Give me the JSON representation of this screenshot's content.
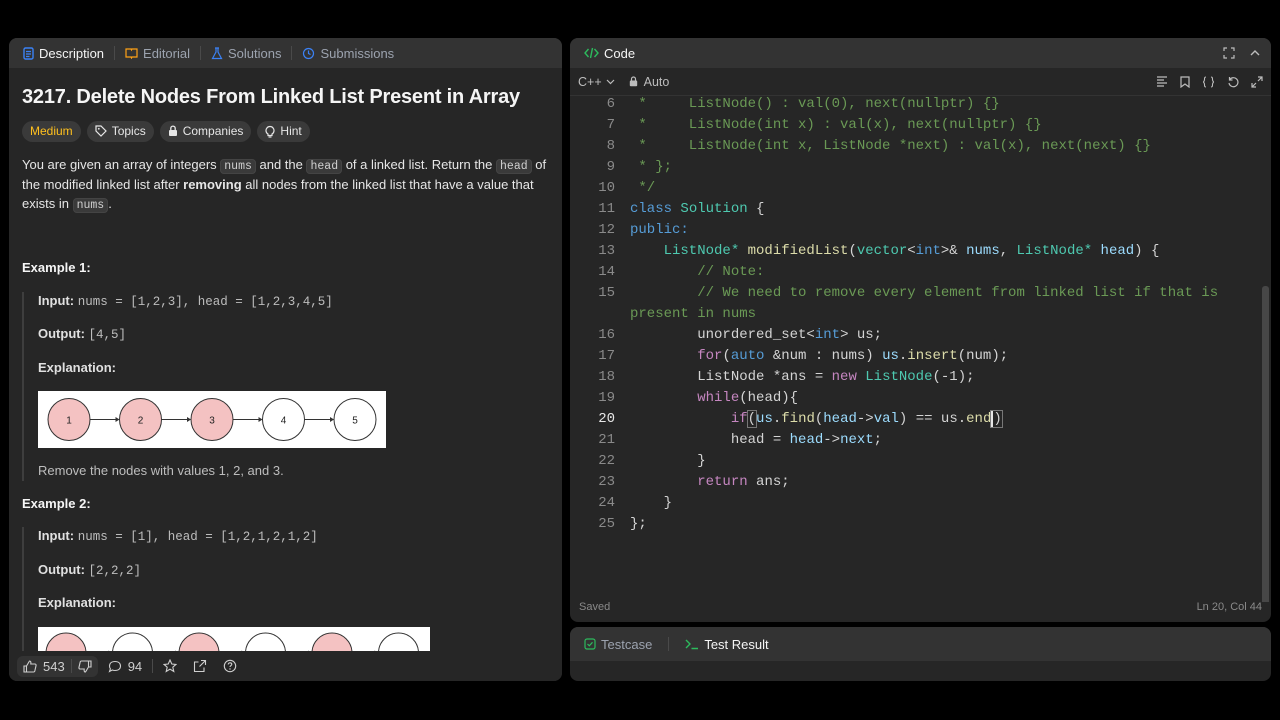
{
  "left_tabs": {
    "description": "Description",
    "editorial": "Editorial",
    "solutions": "Solutions",
    "submissions": "Submissions"
  },
  "problem": {
    "title": "3217. Delete Nodes From Linked List Present in Array",
    "difficulty": "Medium",
    "topics": "Topics",
    "companies": "Companies",
    "hint": "Hint",
    "statement": {
      "p1": "You are given an array of integers ",
      "c1": "nums",
      "p2": " and the ",
      "c2": "head",
      "p3": " of a linked list. Return the ",
      "c3": "head",
      "p4": " of the modified linked list after ",
      "b1": "removing",
      "p5": " all nodes from the linked list that have a value that exists in ",
      "c4": "nums",
      "p6": "."
    },
    "example1": {
      "heading": "Example 1:",
      "input_label": "Input:",
      "input": "nums = [1,2,3], head = [1,2,3,4,5]",
      "output_label": "Output:",
      "output": "[4,5]",
      "explanation_label": "Explanation:",
      "nodes": [
        "1",
        "2",
        "3",
        "4",
        "5"
      ],
      "removed": [
        true,
        true,
        true,
        false,
        false
      ],
      "note": "Remove the nodes with values 1, 2, and 3."
    },
    "example2": {
      "heading": "Example 2:",
      "input_label": "Input:",
      "input": "nums = [1], head = [1,2,1,2,1,2]",
      "output_label": "Output:",
      "output": "[2,2,2]",
      "explanation_label": "Explanation:",
      "removed": [
        true,
        false,
        true,
        false,
        true,
        false
      ]
    }
  },
  "footer": {
    "likes": "543",
    "comments": "94"
  },
  "code_panel": {
    "title": "Code",
    "language": "C++",
    "autosave": "Auto",
    "status_left": "Saved",
    "status_right": "Ln 20, Col 44",
    "active_line": 20,
    "lines": [
      {
        "num": "6"
      },
      {
        "num": "7"
      },
      {
        "num": "8"
      },
      {
        "num": "9"
      },
      {
        "num": "10"
      },
      {
        "num": "11"
      },
      {
        "num": "12"
      },
      {
        "num": "13"
      },
      {
        "num": "14"
      },
      {
        "num": "15"
      },
      {
        "num": ""
      },
      {
        "num": "16"
      },
      {
        "num": "17"
      },
      {
        "num": "18"
      },
      {
        "num": "19"
      },
      {
        "num": "20"
      },
      {
        "num": "21"
      },
      {
        "num": "22"
      },
      {
        "num": "23"
      },
      {
        "num": "24"
      },
      {
        "num": "25"
      }
    ]
  },
  "code_text": {
    "l6": " *     ListNode() : val(0), next(nullptr) {}",
    "l7": " *     ListNode(int x) : val(x), next(nullptr) {}",
    "l8": " *     ListNode(int x, ListNode *next) : val(x), next(next) {}",
    "l9": " * };",
    "l10": " */",
    "l11a": "class",
    "l11b": " Solution",
    "l11c": " {",
    "l12": "public:",
    "l13a": "    ListNode*",
    "l13b": " modifiedList",
    "l13c": "(",
    "l13d": "vector",
    "l13e": "<",
    "l13f": "int",
    "l13g": ">& ",
    "l13h": "nums",
    "l13i": ", ",
    "l13j": "ListNode*",
    "l13k": " head",
    "l13l": ") {",
    "l14": "        // Note:",
    "l15a": "        // We need to remove every element from linked list if that is",
    "l15b": "present in nums",
    "l16a": "        unordered_set<",
    "l16b": "int",
    "l16c": "> us;",
    "l17a": "        ",
    "l17b": "for",
    "l17c": "(",
    "l17d": "auto",
    "l17e": " &num : nums) ",
    "l17f": "us",
    "l17g": ".",
    "l17h": "insert",
    "l17i": "(num);",
    "l18a": "        ListNode *ans = ",
    "l18b": "new",
    "l18c": " ",
    "l18d": "ListNode",
    "l18e": "(-1);",
    "l19a": "        ",
    "l19b": "while",
    "l19c": "(head){",
    "l20a": "            ",
    "l20b": "if",
    "l20c": "(",
    "l20d": "us",
    "l20e": ".",
    "l20f": "find",
    "l20g": "(",
    "l20h": "head",
    "l20i": "->",
    "l20j": "val",
    "l20k": ") == us.",
    "l20l": "end",
    "l20m": ")",
    "l21a": "            head = ",
    "l21b": "head",
    "l21c": "->",
    "l21d": "next",
    "l21e": ";",
    "l22": "        }",
    "l23a": "        ",
    "l23b": "return",
    "l23c": " ans;",
    "l24": "    }",
    "l25": "};"
  },
  "bottom_tabs": {
    "testcase": "Testcase",
    "test_result": "Test Result"
  },
  "colors": {
    "removed_node": "#f4c2c2",
    "kept_node": "#ffffff",
    "medium": "#ffc01e",
    "accent_green": "#2cbb5d"
  }
}
